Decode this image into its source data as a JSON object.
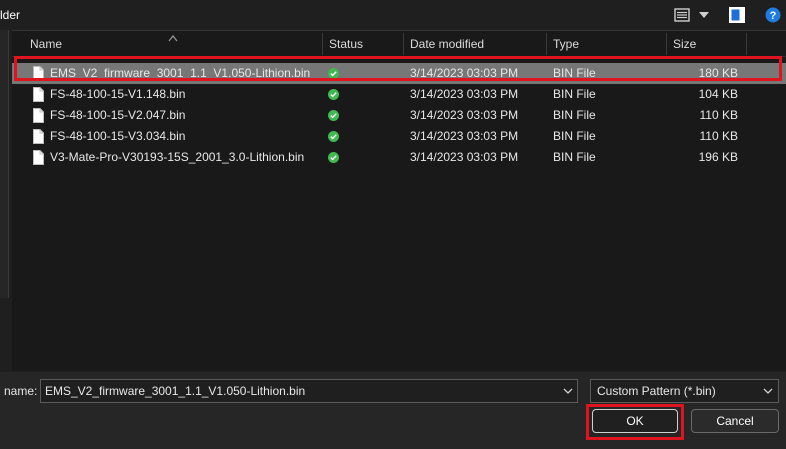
{
  "title": "lder",
  "icons": {
    "view": "view-list-icon",
    "view_dropdown": "chevron-down-icon",
    "preview_pane": "preview-pane-icon",
    "help": "help-icon"
  },
  "columns": {
    "name": "Name",
    "status": "Status",
    "date_modified": "Date modified",
    "type": "Type",
    "size": "Size"
  },
  "files": [
    {
      "name": "EMS_V2_firmware_3001_1.1_V1.050-Lithion.bin",
      "status_icon": "synced-check-icon",
      "date": "3/14/2023 03:03 PM",
      "type": "BIN File",
      "size": "180 KB",
      "selected": true
    },
    {
      "name": "FS-48-100-15-V1.148.bin",
      "status_icon": "synced-check-icon",
      "date": "3/14/2023 03:03 PM",
      "type": "BIN File",
      "size": "104 KB",
      "selected": false
    },
    {
      "name": "FS-48-100-15-V2.047.bin",
      "status_icon": "synced-check-icon",
      "date": "3/14/2023 03:03 PM",
      "type": "BIN File",
      "size": "110 KB",
      "selected": false
    },
    {
      "name": "FS-48-100-15-V3.034.bin",
      "status_icon": "synced-check-icon",
      "date": "3/14/2023 03:03 PM",
      "type": "BIN File",
      "size": "110 KB",
      "selected": false
    },
    {
      "name": "V3-Mate-Pro-V30193-15S_2001_3.0-Lithion.bin",
      "status_icon": "synced-check-icon",
      "date": "3/14/2023 03:03 PM",
      "type": "BIN File",
      "size": "196 KB",
      "selected": false
    }
  ],
  "footer": {
    "filename_label": "name:",
    "filename_value": "EMS_V2_firmware_3001_1.1_V1.050-Lithion.bin",
    "file_type": "Custom Pattern (*.bin)",
    "ok_label": "OK",
    "cancel_label": "Cancel"
  },
  "colors": {
    "highlight": "#e0141e",
    "selected_row": "#777777",
    "status_green": "#3fb950"
  }
}
